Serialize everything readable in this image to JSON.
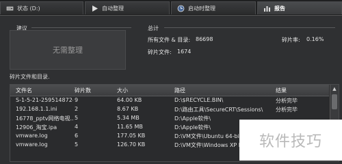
{
  "tabs": [
    {
      "label": "状态 (D:)",
      "icon": "disk-icon"
    },
    {
      "label": "自动整理",
      "icon": "play-icon"
    },
    {
      "label": "启动时整理",
      "icon": "clock-icon"
    },
    {
      "label": "报告",
      "icon": "report-icon"
    }
  ],
  "suggestion": {
    "title": "建议",
    "text": "无需整理"
  },
  "summary": {
    "title": "总计",
    "files_dirs_label": "所有文件 & 目录:",
    "files_dirs_value": "86698",
    "fragmented_files_label": "碎片文件:",
    "fragmented_files_value": "1674",
    "fragmentation_label": "碎片率:",
    "fragmentation_value": "0.16%"
  },
  "list": {
    "title": "碎片文件和目录.",
    "headers": [
      "文件名",
      "碎片数",
      "大小",
      "路径",
      "结果"
    ],
    "rows": [
      [
        "S-1-5-21-259514872-...",
        "9",
        "64.00 KB",
        "D:\\$RECYCLE.BIN\\",
        "分析完毕"
      ],
      [
        "192.168.1.1.ini",
        "2",
        "8.67 KB",
        "D:\\路由工具\\SecureCRT\\Sessions\\",
        "分析完毕"
      ],
      [
        "16778_pptv网络电视...",
        "5",
        "5.34 MB",
        "D:\\Apple软件\\",
        ""
      ],
      [
        "12906_淘宝.ipa",
        "4",
        "11.65 MB",
        "D:\\Apple软件\\",
        ""
      ],
      [
        "vmware.log",
        "6",
        "177.05 KB",
        "D:\\VM文件\\Ubuntu 64-bit\\",
        ""
      ],
      [
        "vmware.log",
        "5",
        "126.70 KB",
        "D:\\VM文件\\Windows XP Professional\\",
        ""
      ],
      [
        "",
        "",
        "",
        "",
        ""
      ]
    ]
  },
  "watermark": "软件技巧"
}
